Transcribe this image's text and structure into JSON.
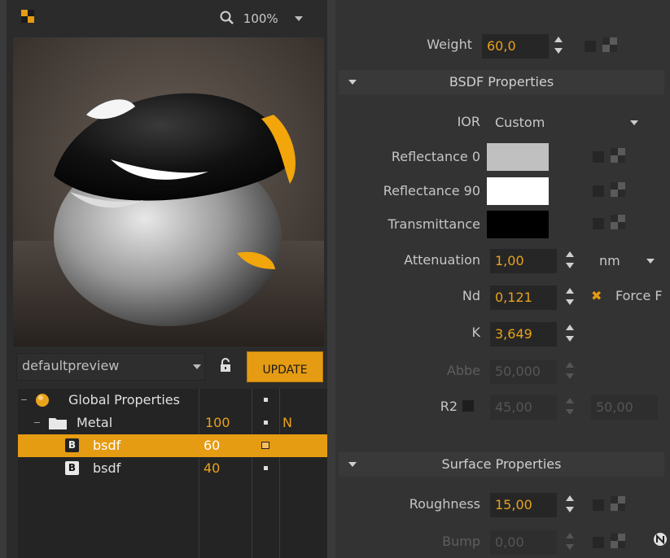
{
  "toolbar": {
    "zoom_label": "100%"
  },
  "preview": {
    "scene_select_value": "defaultpreview",
    "update_label": "UPDATE"
  },
  "tree": {
    "rows": [
      {
        "name": "Global Properties",
        "value": "",
        "flag": ""
      },
      {
        "name": "Metal",
        "value": "100",
        "flag": "N"
      },
      {
        "badge": "B",
        "name": "bsdf",
        "value": "60",
        "flag": ""
      },
      {
        "badge": "B",
        "name": "bsdf",
        "value": "40",
        "flag": ""
      }
    ]
  },
  "props": {
    "weight_label": "Weight",
    "weight_value": "60,0",
    "bsdf_section": "BSDF Properties",
    "ior_label": "IOR",
    "ior_value": "Custom",
    "reflectance0_label": "Reflectance 0",
    "reflectance90_label": "Reflectance 90",
    "transmittance_label": "Transmittance",
    "attenuation_label": "Attenuation",
    "attenuation_value": "1,00",
    "attenuation_unit": "nm",
    "nd_label": "Nd",
    "nd_value": "0,121",
    "force_label": "Force F",
    "k_label": "K",
    "k_value": "3,649",
    "abbe_label": "Abbe",
    "abbe_value": "50,000",
    "r2_label": "R2",
    "r2_value1": "45,00",
    "r2_value2": "50,00",
    "surface_section": "Surface Properties",
    "roughness_label": "Roughness",
    "roughness_value": "15,00",
    "bump_label": "Bump",
    "bump_value": "0,00"
  },
  "colors": {
    "accent": "#e59b12",
    "reflectance0": "#c0c0c0",
    "reflectance90": "#ffffff",
    "transmittance": "#000000"
  }
}
